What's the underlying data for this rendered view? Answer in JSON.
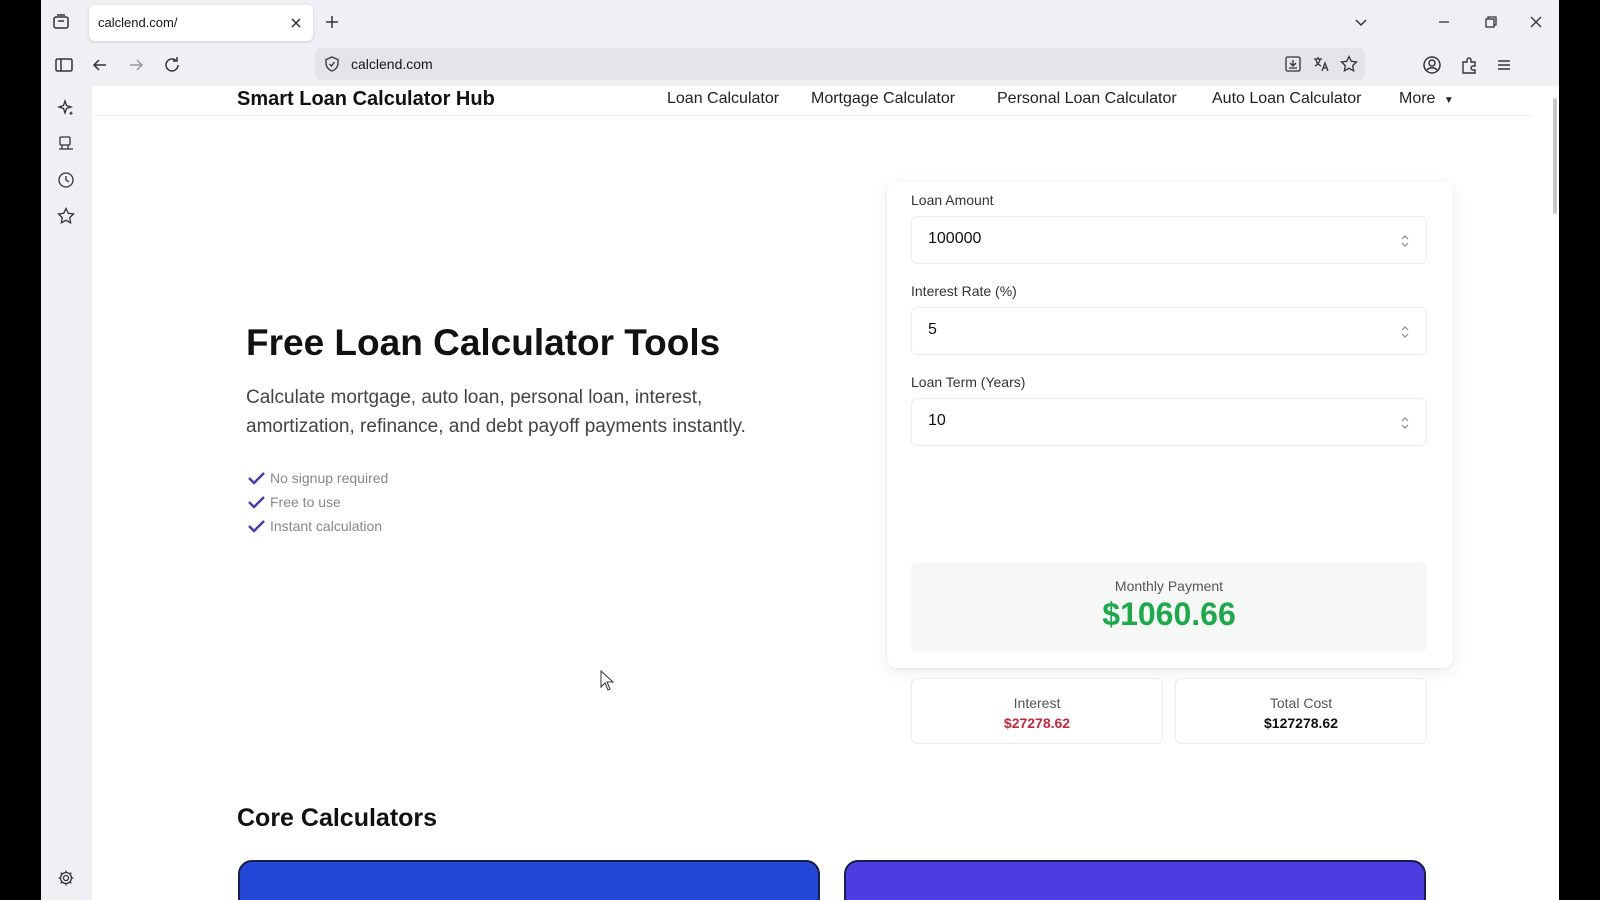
{
  "browser": {
    "tab": {
      "title": "calclend.com/"
    },
    "address_bar": {
      "url": "calclend.com"
    }
  },
  "site": {
    "brand": "Smart Loan Calculator Hub",
    "nav": [
      {
        "label": "Loan Calculator"
      },
      {
        "label": "Mortgage Calculator"
      },
      {
        "label": "Personal Loan Calculator"
      },
      {
        "label": "Auto Loan Calculator"
      },
      {
        "label": "More"
      }
    ]
  },
  "hero": {
    "title": "Free Loan Calculator Tools",
    "subtitle": "Calculate mortgage, auto loan, personal loan, interest, amortization, refinance, and debt payoff payments instantly.",
    "features": [
      "No signup required",
      "Free to use",
      "Instant calculation"
    ]
  },
  "calculator": {
    "loan_amount": {
      "label": "Loan Amount",
      "value": "100000"
    },
    "interest_rate": {
      "label": "Interest Rate (%)",
      "value": "5"
    },
    "loan_term": {
      "label": "Loan Term (Years)",
      "value": "10"
    },
    "monthly_payment": {
      "label": "Monthly Payment",
      "value": "$1060.66"
    },
    "interest": {
      "label": "Interest",
      "value": "$27278.62"
    },
    "total_cost": {
      "label": "Total Cost",
      "value": "$127278.62"
    }
  },
  "core": {
    "title": "Core Calculators"
  },
  "colors": {
    "accent_green": "#1ea84a",
    "interest_red": "#c0283c",
    "check_purple": "#4a3ea8",
    "card_blue": "#2346d6",
    "card_indigo": "#4b3de0"
  }
}
